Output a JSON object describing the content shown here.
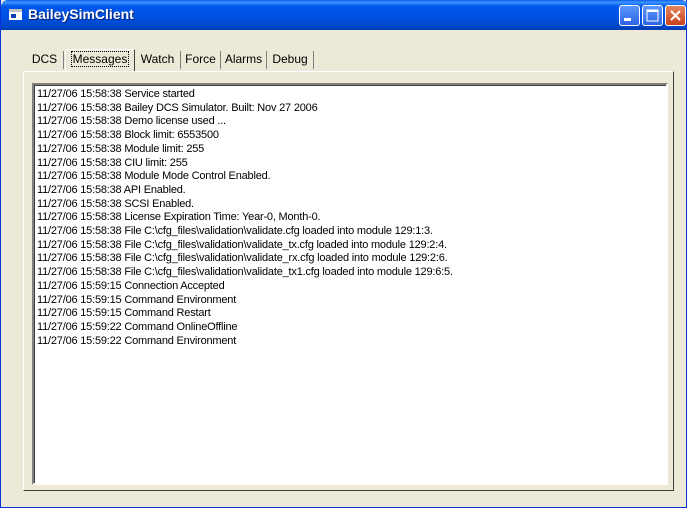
{
  "window": {
    "title": "BaileySimClient"
  },
  "tabs": [
    {
      "label": "DCS"
    },
    {
      "label": "Messages"
    },
    {
      "label": "Watch"
    },
    {
      "label": "Force"
    },
    {
      "label": "Alarms"
    },
    {
      "label": "Debug"
    }
  ],
  "messages": [
    "11/27/06 15:58:38 Service started",
    "11/27/06 15:58:38 Bailey DCS Simulator. Built: Nov 27 2006",
    "11/27/06 15:58:38 Demo license used ...",
    "11/27/06 15:58:38 Block limit: 6553500",
    "11/27/06 15:58:38 Module limit: 255",
    "11/27/06 15:58:38 CIU limit: 255",
    "11/27/06 15:58:38 Module Mode Control Enabled.",
    "11/27/06 15:58:38 API Enabled.",
    "11/27/06 15:58:38 SCSI Enabled.",
    "11/27/06 15:58:38 License Expiration Time: Year-0, Month-0.",
    "11/27/06 15:58:38 File C:\\cfg_files\\validation\\validate.cfg loaded into module 129:1:3.",
    "11/27/06 15:58:38 File C:\\cfg_files\\validation\\validate_tx.cfg loaded into module 129:2:4.",
    "11/27/06 15:58:38 File C:\\cfg_files\\validation\\validate_rx.cfg loaded into module 129:2:6.",
    "11/27/06 15:58:38 File C:\\cfg_files\\validation\\validate_tx1.cfg loaded into module 129:6:5.",
    "11/27/06 15:59:15 Connection Accepted",
    "11/27/06 15:59:15 Command Environment",
    "11/27/06 15:59:15 Command Restart",
    "11/27/06 15:59:22 Command OnlineOffline",
    "11/27/06 15:59:22 Command Environment"
  ]
}
